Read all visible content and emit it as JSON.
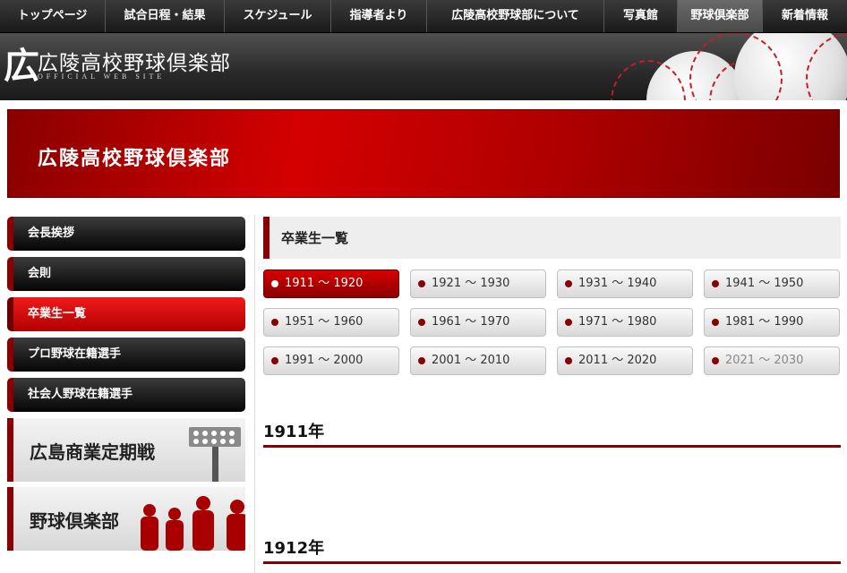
{
  "nav": {
    "items": [
      "トップページ",
      "試合日程・結果",
      "スケジュール",
      "指導者より",
      "広陵高校野球部について",
      "写真館",
      "野球倶楽部",
      "新着情報"
    ],
    "active_index": 6
  },
  "header": {
    "logo_letter": "広",
    "site_title": "広陵高校野球倶楽部",
    "site_subtitle": "OFFICIAL WEB SITE"
  },
  "banner": {
    "title": "広陵高校野球倶楽部"
  },
  "sidebar": {
    "items": [
      "会長挨拶",
      "会則",
      "卒業生一覧",
      "プロ野球在籍選手",
      "社会人野球在籍選手"
    ],
    "active_index": 2,
    "banners": [
      "広島商業定期戦",
      "野球倶楽部"
    ]
  },
  "main": {
    "section_title": "卒業生一覧",
    "decades": [
      "1911 〜 1920",
      "1921 〜 1930",
      "1931 〜 1940",
      "1941 〜 1950",
      "1951 〜 1960",
      "1961 〜 1970",
      "1971 〜 1980",
      "1981 〜 1990",
      "1991 〜 2000",
      "2001 〜 2010",
      "2011 〜 2020",
      "2021 〜 2030"
    ],
    "active_decade": 0,
    "disabled_decade": 11,
    "years": [
      "1911年",
      "1912年"
    ]
  },
  "colors": {
    "accent": "#8a0000",
    "banner_red": "#d40000",
    "nav_bg": "#1a1a1a"
  }
}
